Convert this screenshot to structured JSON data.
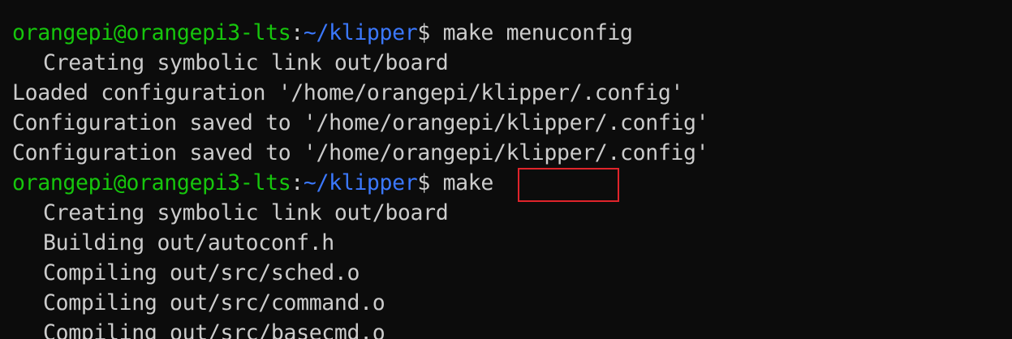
{
  "terminal": {
    "prompt_user": "orangepi@orangepi3-lts",
    "prompt_colon": ":",
    "prompt_path": "~/klipper",
    "prompt_dollar": "$",
    "lines": [
      {
        "type": "prompt",
        "command": " make menuconfig"
      },
      {
        "type": "output",
        "indent": true,
        "text": "Creating symbolic link out/board"
      },
      {
        "type": "output",
        "indent": false,
        "text": "Loaded configuration '/home/orangepi/klipper/.config'"
      },
      {
        "type": "output",
        "indent": false,
        "text": "Configuration saved to '/home/orangepi/klipper/.config'"
      },
      {
        "type": "output",
        "indent": false,
        "text": "Configuration saved to '/home/orangepi/klipper/.config'"
      },
      {
        "type": "prompt",
        "command": " make",
        "highlighted": true
      },
      {
        "type": "output",
        "indent": true,
        "text": "Creating symbolic link out/board"
      },
      {
        "type": "output",
        "indent": true,
        "text": "Building out/autoconf.h"
      },
      {
        "type": "output",
        "indent": true,
        "text": "Compiling out/src/sched.o"
      },
      {
        "type": "output",
        "indent": true,
        "text": "Compiling out/src/command.o"
      },
      {
        "type": "output",
        "indent": true,
        "text": "Compiling out/src/basecmd.o"
      }
    ]
  },
  "colors": {
    "background": "#0c0c0c",
    "text": "#cccccc",
    "user": "#16c60c",
    "path": "#3b78ff",
    "highlight": "#e0242b"
  }
}
